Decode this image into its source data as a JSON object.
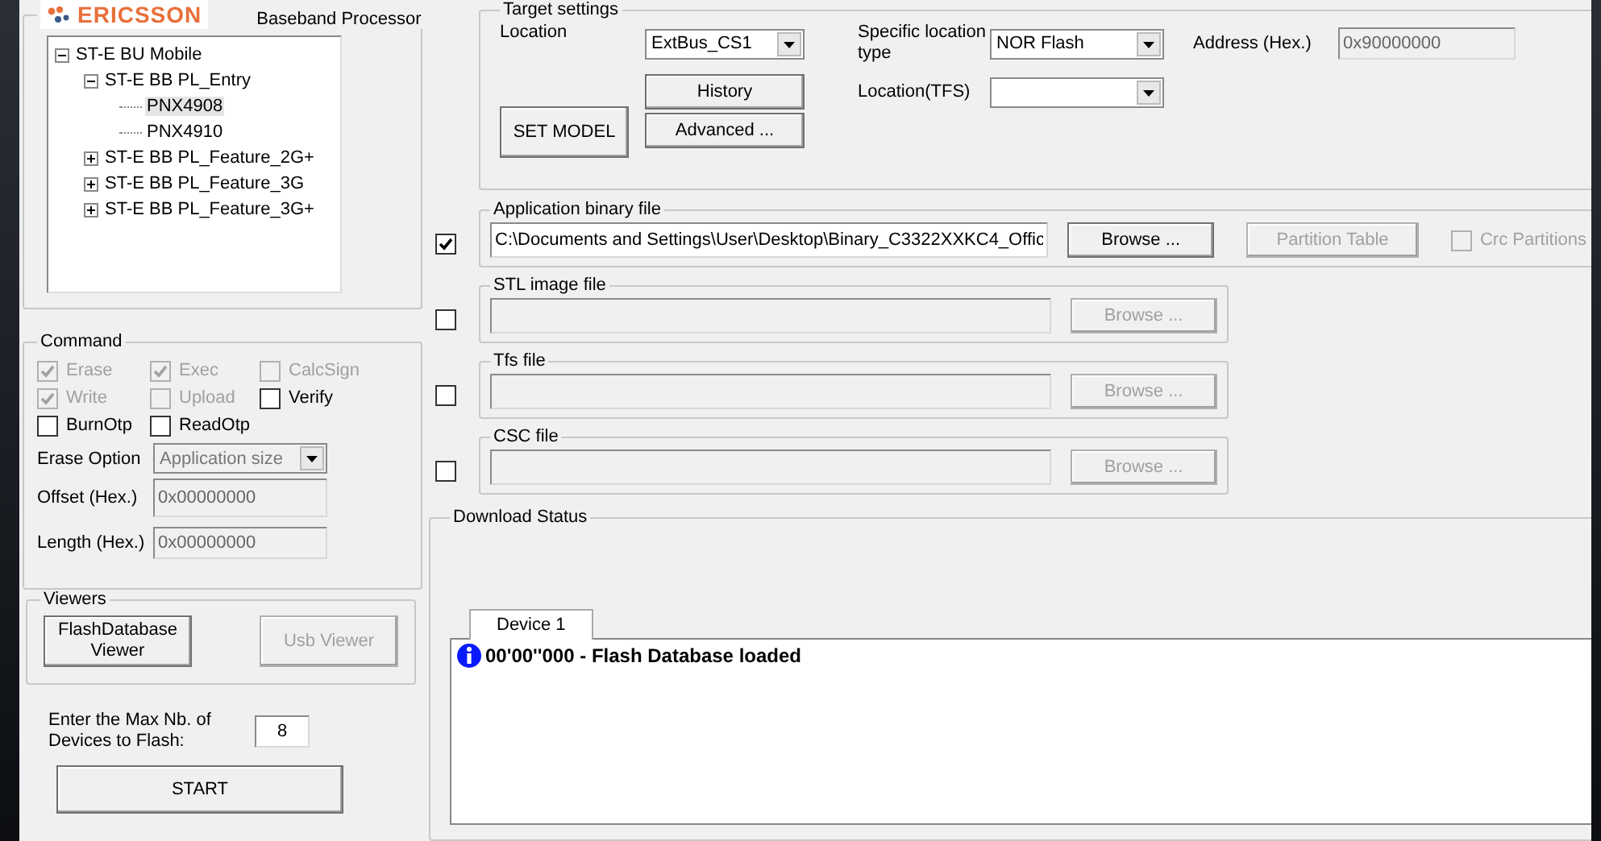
{
  "header": {
    "logo_text": "ERICSSON",
    "processor_label": "Baseband Processor"
  },
  "tree": [
    {
      "label": "ST-E BU Mobile",
      "expanded": true,
      "selected": false,
      "children": [
        {
          "label": "ST-E BB PL_Entry",
          "expanded": true,
          "selected": false,
          "children": [
            {
              "label": "PNX4908",
              "selected": true
            },
            {
              "label": "PNX4910",
              "selected": false
            }
          ]
        },
        {
          "label": "ST-E BB PL_Feature_2G+",
          "expanded": false,
          "selected": false
        },
        {
          "label": "ST-E BB PL_Feature_3G",
          "expanded": false,
          "selected": false
        },
        {
          "label": "ST-E BB PL_Feature_3G+",
          "expanded": false,
          "selected": false
        }
      ]
    }
  ],
  "command": {
    "title": "Command",
    "checkboxes": [
      {
        "label": "Erase",
        "checked": true,
        "disabled": true
      },
      {
        "label": "Exec",
        "checked": true,
        "disabled": true
      },
      {
        "label": "CalcSign",
        "checked": false,
        "disabled": true
      },
      {
        "label": "Write",
        "checked": true,
        "disabled": true
      },
      {
        "label": "Upload",
        "checked": false,
        "disabled": true
      },
      {
        "label": "Verify",
        "checked": false,
        "disabled": false
      },
      {
        "label": "BurnOtp",
        "checked": false,
        "disabled": false
      },
      {
        "label": "ReadOtp",
        "checked": false,
        "disabled": false
      }
    ],
    "fields": [
      {
        "kind": "dropdown",
        "label": "Erase Option",
        "value": "Application size",
        "disabled": true
      },
      {
        "kind": "text",
        "label": "Offset (Hex.)",
        "value": "0x00000000",
        "disabled": true
      },
      {
        "kind": "text",
        "label": "Length (Hex.)",
        "value": "0x00000000",
        "disabled": true
      }
    ]
  },
  "viewers": {
    "title": "Viewers",
    "buttons": [
      {
        "label": "FlashDatabase Viewer",
        "disabled": false
      },
      {
        "label": "Usb Viewer",
        "disabled": true
      }
    ]
  },
  "max_devices": {
    "label": "Enter the Max Nb. of Devices to Flash:",
    "value": "8"
  },
  "start_button": "START",
  "target": {
    "title": "Target settings",
    "location_label": "Location",
    "location_value": "ExtBus_CS1",
    "history_button": "History",
    "advanced_button": "Advanced ...",
    "set_model_button": "SET MODEL",
    "type_label": "Specific location type",
    "type_value": "NOR Flash",
    "tfs_label": "Location(TFS)",
    "address_label": "Address (Hex.)",
    "address_value": "0x90000000"
  },
  "files": [
    {
      "title": "Application binary file",
      "checked": true,
      "value": "C:\\Documents and Settings\\User\\Desktop\\Binary_C3322XXKC4_Offic",
      "browse": {
        "label": "Browse ...",
        "disabled": false
      },
      "partition_button": {
        "label": "Partition Table",
        "disabled": true
      },
      "crc": {
        "label": "Crc Partitions",
        "checked": false,
        "disabled": true
      }
    },
    {
      "title": "STL image file",
      "checked": false,
      "browse": {
        "label": "Browse ...",
        "disabled": true
      }
    },
    {
      "title": "Tfs file",
      "checked": false,
      "browse": {
        "label": "Browse ...",
        "disabled": true
      }
    },
    {
      "title": "CSC file",
      "checked": false,
      "browse": {
        "label": "Browse ...",
        "disabled": true
      }
    }
  ],
  "download": {
    "title": "Download Status",
    "tabs": [
      {
        "label": "Device 1",
        "selected": true
      }
    ],
    "log": [
      {
        "kind": "info",
        "text": "00'00''000 - Flash Database loaded"
      }
    ]
  }
}
